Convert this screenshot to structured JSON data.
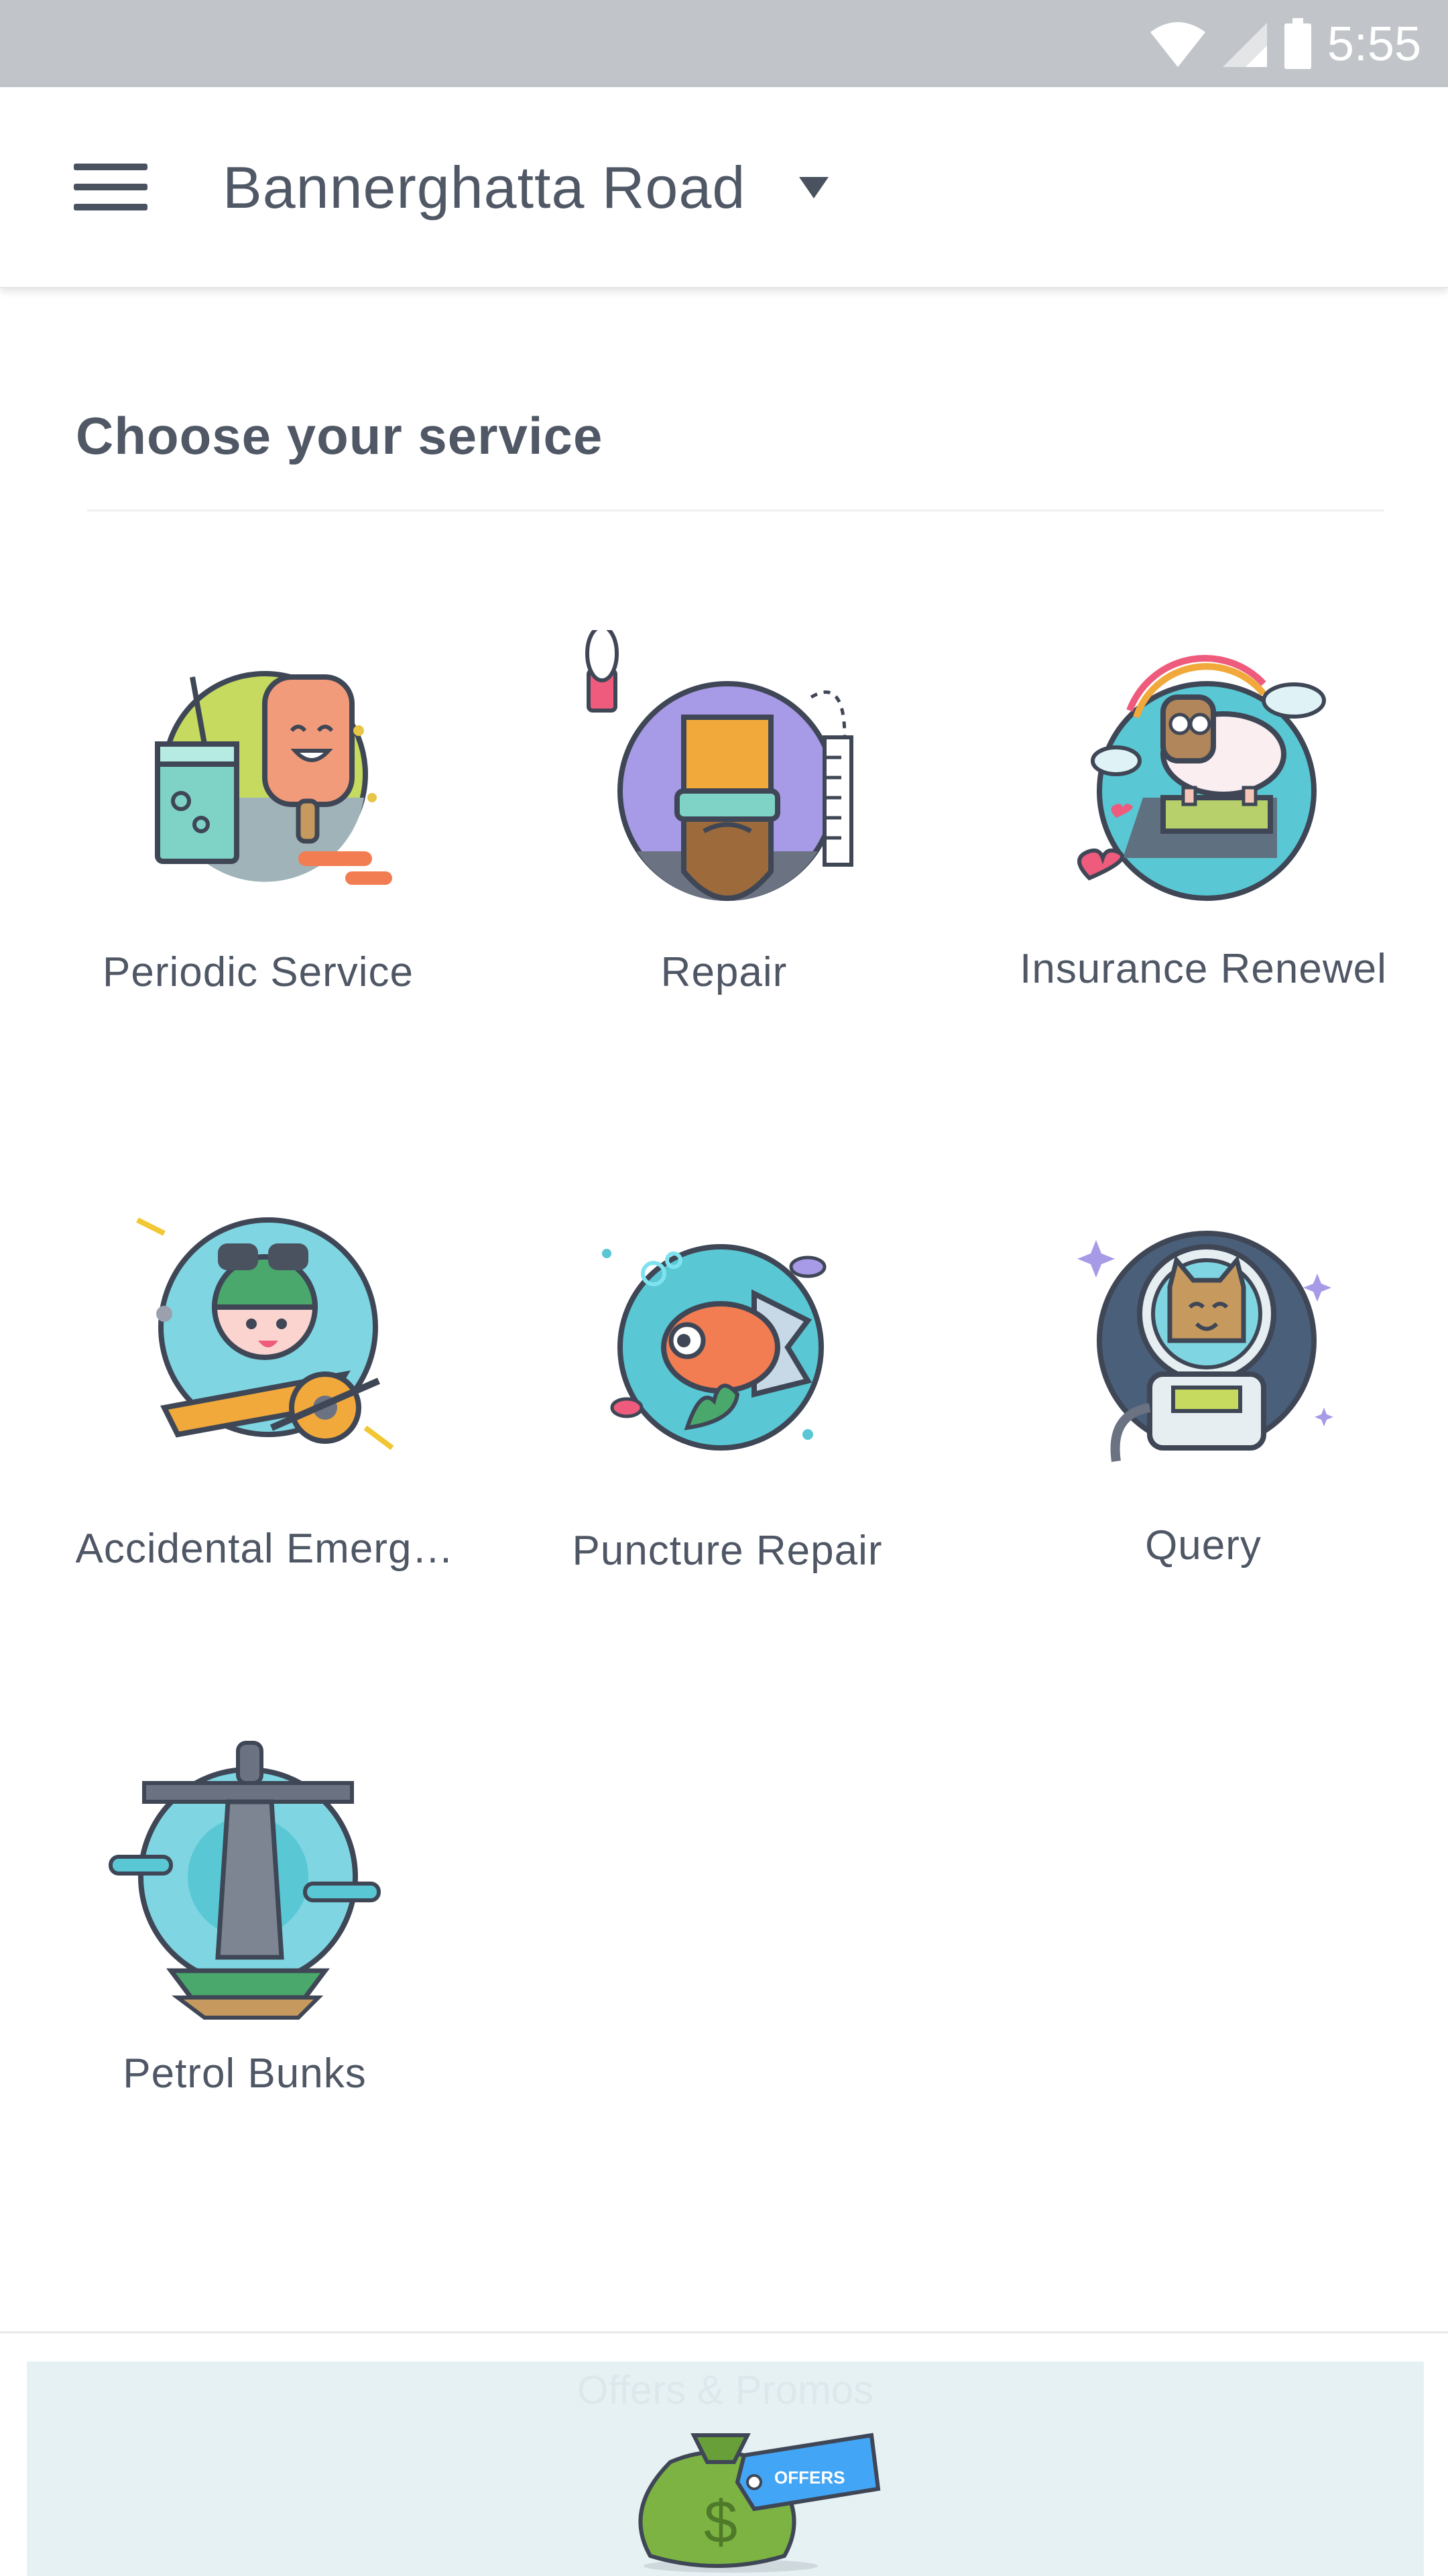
{
  "status_bar": {
    "time": "5:55",
    "icons": [
      "wifi-icon",
      "signal-icon",
      "battery-icon"
    ]
  },
  "app_bar": {
    "menu_icon": "hamburger-menu-icon",
    "location": "Bannerghatta Road",
    "dropdown_icon": "dropdown-arrow-icon"
  },
  "main": {
    "section_title": "Choose your service",
    "services": [
      {
        "label": "Periodic Service",
        "icon": "ice-cream-drink-icon"
      },
      {
        "label": "Repair",
        "icon": "bearded-man-icon"
      },
      {
        "label": "Insurance Renewel",
        "icon": "sheep-icon"
      },
      {
        "label": "Accidental Emerg…",
        "icon": "pilot-plane-icon"
      },
      {
        "label": "Puncture Repair",
        "icon": "goldfish-icon"
      },
      {
        "label": "Query",
        "icon": "astronaut-cat-icon"
      },
      {
        "label": "Petrol Bunks",
        "icon": "statue-icon"
      }
    ]
  },
  "offers": {
    "ghost_text": "Offers & Promos",
    "tag_text": "OFFERS",
    "icon": "money-bag-offers-icon"
  },
  "colors": {
    "status_bar": "#c1c5c9",
    "text": "#4a5260",
    "offers_background": "#e6f1f4"
  }
}
